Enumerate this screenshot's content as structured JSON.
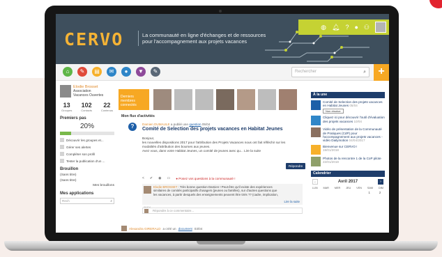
{
  "colors": {
    "header_bg": "#3e4f5d",
    "accent_orange": "#f7a823",
    "lime": "#c5d233",
    "navy": "#1e3d6b",
    "logo": "#f5b335"
  },
  "header": {
    "logo": "CERVO",
    "tagline_line1": "La communauté en ligne d'échanges et de ressources",
    "tagline_line2": "pour l'accompagnement aux projets vacances",
    "top_icons": [
      "globe-icon",
      "bell-icon",
      "help-icon",
      "user-icon",
      "group-icon"
    ]
  },
  "nav": {
    "icons": [
      {
        "name": "home-icon",
        "color": "#5fb648",
        "glyph": "⌂"
      },
      {
        "name": "tools-icon",
        "color": "#e04b3b",
        "glyph": "✎"
      },
      {
        "name": "document-icon",
        "color": "#f6b02b",
        "glyph": "▤"
      },
      {
        "name": "mail-icon",
        "color": "#2f86c8",
        "glyph": "✉"
      },
      {
        "name": "chat-icon",
        "color": "#2f86c8",
        "glyph": "●"
      },
      {
        "name": "filter-icon",
        "color": "#8e4a9a",
        "glyph": "▼"
      },
      {
        "name": "edit-icon",
        "color": "#5a6877",
        "glyph": "✎"
      }
    ],
    "search_placeholder": "Rechercher"
  },
  "sidebar": {
    "user_name": "Elodie Brosset",
    "user_org_line1": "Association",
    "user_org_line2": "Vacances Ouvertes",
    "stats": [
      {
        "value": "13",
        "label": "Groupes"
      },
      {
        "value": "102",
        "label": "Contacts"
      },
      {
        "value": "22",
        "label": "Contenus"
      }
    ],
    "first_steps_title": "Premiers pas",
    "progress_label": "20%",
    "progress_value": 0.2,
    "steps": [
      "Découvrir les groupes et...",
      "Gérer ses alertes",
      "Compléter son profil",
      "Tester la publication d'un ..."
    ],
    "drafts_title": "Brouillon",
    "drafts": [
      "(Sans titre)",
      "(Sans titre)"
    ],
    "my_drafts_link": "Mes brouillons",
    "apps_title": "Mes applications",
    "apps_search": "Rech"
  },
  "main": {
    "members_label": "Derniers membres connectés",
    "feed_title": "Mon flux d'activités",
    "post": {
      "author": "Damien DUMAULE",
      "action": "a publié une",
      "action_link": "question",
      "date": "05/04",
      "title": "Comité de Selection des projets vacances en Habitat Jeunes",
      "body_line1": "Bonjour,",
      "body_line2": "les nouvelles dispositions 2017 pour l'attribution des Projets Vacances nous ont fait réfléchir sur les",
      "body_line3": "modalités d'attribution des bourses aux jeunes.",
      "body_line4": "Avez vous, dans votre Habitat Jeunes, un comité de jeunes avec qu... Lire la suite",
      "respond_button": "Répondre",
      "question_prompt": "Posez vos questions à la communauté !"
    },
    "comment": {
      "author": "Elodie BROSSET",
      "text_line1": ": Très bonne question Damien ! Peut-être qu'il existe des expériences",
      "text_line2": "similaires de comités participatifs d'usagers (jeunes ou familles), sur d'autres questions que",
      "text_line3": "les vacances, à partir desquels des enseignements peuvent être tirés ?? (cadre, implication,",
      "more": "Lire la suite",
      "date": "06/04"
    },
    "reply_placeholder": "Répondre à ce commentaire...",
    "post2": {
      "author": "Alexandra GIRERALD",
      "action": "a créé un",
      "link": "document",
      "date": "03/04"
    }
  },
  "right": {
    "news_title": "À la une",
    "news": [
      {
        "thumb": "#1d5fa8",
        "text": "Comité de Selection des projets vacances en Habitat Jeunes",
        "date": "05/04",
        "badge": "Non résolue"
      },
      {
        "thumb": "#2f86c8",
        "text": "Cliquez ici pour découvrir l'outil d'évaluation des projets vacances",
        "date": "10/04",
        "badge": ""
      },
      {
        "thumb": "#8a7060",
        "text": "Vidéo de présentation de la Communauté de Pratiques (CdP) pour l'accompagnement aux projets vacances - vidéo Dailymotion",
        "date": "04/04/2017",
        "badge": ""
      },
      {
        "thumb": "#f6b02b",
        "text": "Bienvenue sur CERVO !",
        "date": "19/01/2018",
        "badge": ""
      },
      {
        "thumb": "#8fa06a",
        "text": "Photos de la rencontre 1 de la CoP pilote",
        "date": "22/01/2018",
        "badge": ""
      }
    ],
    "calendar_title": "Calendrier",
    "calendar_month": "Avril 2017",
    "weekdays": [
      "LUN",
      "MAR",
      "MER",
      "JEU",
      "VEN",
      "SAM",
      "DIM"
    ],
    "first_row": [
      "",
      "",
      "",
      "",
      "",
      "1",
      "2"
    ]
  }
}
